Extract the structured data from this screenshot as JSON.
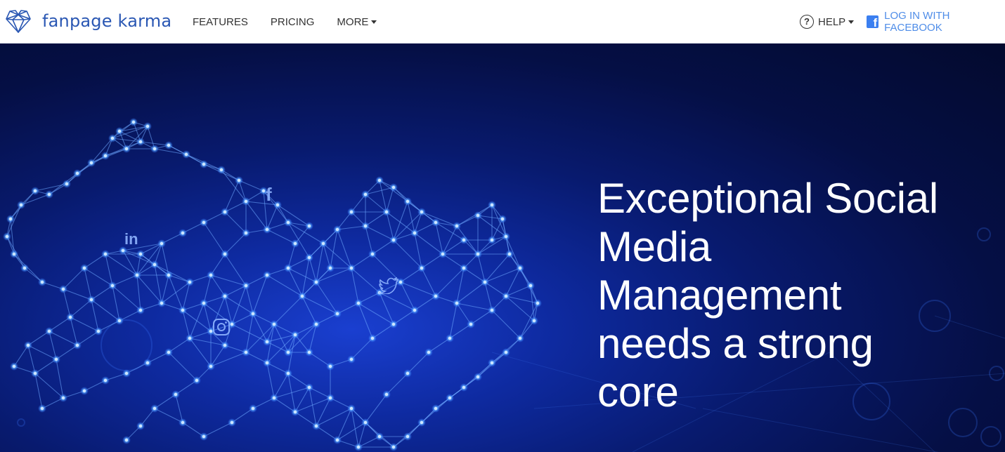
{
  "brand": {
    "name": "fanpage karma",
    "logo_icon": "heart-network-logo-icon"
  },
  "nav": {
    "items": [
      {
        "label": "FEATURES"
      },
      {
        "label": "PRICING"
      },
      {
        "label": "MORE"
      }
    ]
  },
  "header": {
    "help_label": "HELP",
    "help_icon": "question-circle-icon",
    "login_label": "LOG IN WITH FACEBOOK",
    "login_icon": "facebook-icon"
  },
  "hero": {
    "headline": "Exceptional Social Media Management needs a strong core",
    "social_icons": [
      "linkedin-icon",
      "facebook-icon",
      "twitter-icon",
      "instagram-icon"
    ]
  },
  "colors": {
    "brand_blue": "#2a57b3",
    "link_blue": "#4f8de8",
    "hero_dark": "#030a2e",
    "hero_glow": "#1a3fd0"
  }
}
